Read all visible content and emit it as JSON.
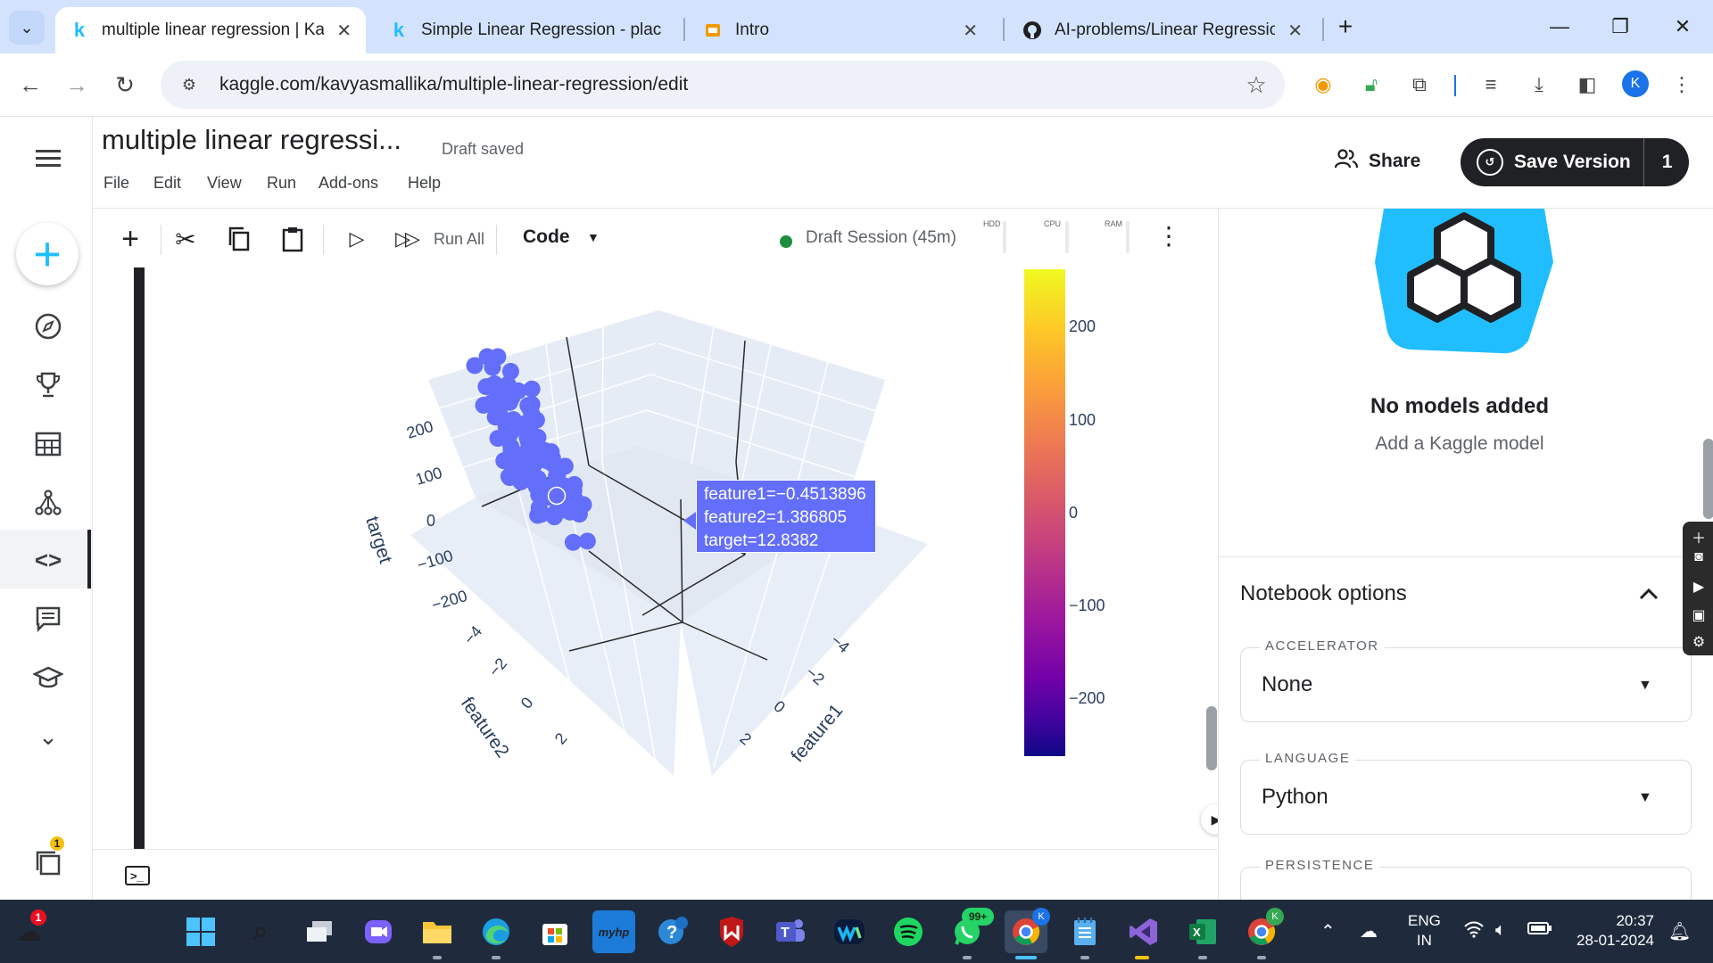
{
  "browser": {
    "tabs": [
      {
        "title": "multiple linear regression | Kag",
        "favicon": "kaggle-k-icon",
        "active": true
      },
      {
        "title": "Simple Linear Regression - plac",
        "favicon": "kaggle-k-icon",
        "active": false
      },
      {
        "title": "Intro",
        "favicon": "slides-icon",
        "active": false
      },
      {
        "title": "AI-problems/Linear Regression/",
        "favicon": "github-icon",
        "active": false
      }
    ],
    "new_tab": "+",
    "url": "kaggle.com/kavyasmallika/multiple-linear-regression/edit",
    "profile_initial": "K"
  },
  "notebook": {
    "title": "multiple linear regressi...",
    "status": "Draft saved",
    "menu": [
      "File",
      "Edit",
      "View",
      "Run",
      "Add-ons",
      "Help"
    ],
    "share_label": "Share",
    "save_label": "Save Version",
    "version_count": "1",
    "toolbar": {
      "run_all_label": "Run All",
      "cell_type": "Code",
      "session_label": "Draft Session (45m)",
      "meters": [
        "HDD",
        "CPU",
        "RAM"
      ]
    }
  },
  "plot": {
    "z_ticks": [
      "200",
      "100",
      "0",
      "−100",
      "−200"
    ],
    "z_label": "target",
    "feature2_ticks": [
      "−4",
      "−2",
      "0",
      "2"
    ],
    "feature2_label": "feature2",
    "feature1_ticks": [
      "−4",
      "−2",
      "0",
      "2"
    ],
    "feature1_label": "feature1",
    "colorbar_ticks": [
      "200",
      "100",
      "0",
      "−100",
      "−200"
    ],
    "hover": {
      "line1": "feature1=−0.4513896",
      "line2": "feature2=1.386805",
      "line3": "target=12.8382"
    },
    "marker_color": "#636efa"
  },
  "chart_data": {
    "type": "scatter",
    "title": "",
    "axes": {
      "x": "feature1",
      "y": "feature2",
      "z": "target"
    },
    "x_range": [
      -4,
      2
    ],
    "y_range": [
      -4,
      2
    ],
    "z_range": [
      -200,
      200
    ],
    "highlighted_point": {
      "feature1": -0.4513896,
      "feature2": 1.386805,
      "target": 12.8382
    },
    "colorscale": "plasma",
    "colorbar_range": [
      -250,
      250
    ]
  },
  "right_panel": {
    "no_models_title": "No models added",
    "no_models_sub": "Add a Kaggle model",
    "options_title": "Notebook options",
    "fields": [
      {
        "label": "ACCELERATOR",
        "value": "None"
      },
      {
        "label": "LANGUAGE",
        "value": "Python"
      },
      {
        "label": "PERSISTENCE",
        "value": ""
      }
    ]
  },
  "taskbar": {
    "weather_badge": "1",
    "whatsapp_badge": "99+",
    "lang_line1": "ENG",
    "lang_line2": "IN",
    "time": "20:37",
    "date": "28-01-2024",
    "left_rail_badge": "1"
  }
}
